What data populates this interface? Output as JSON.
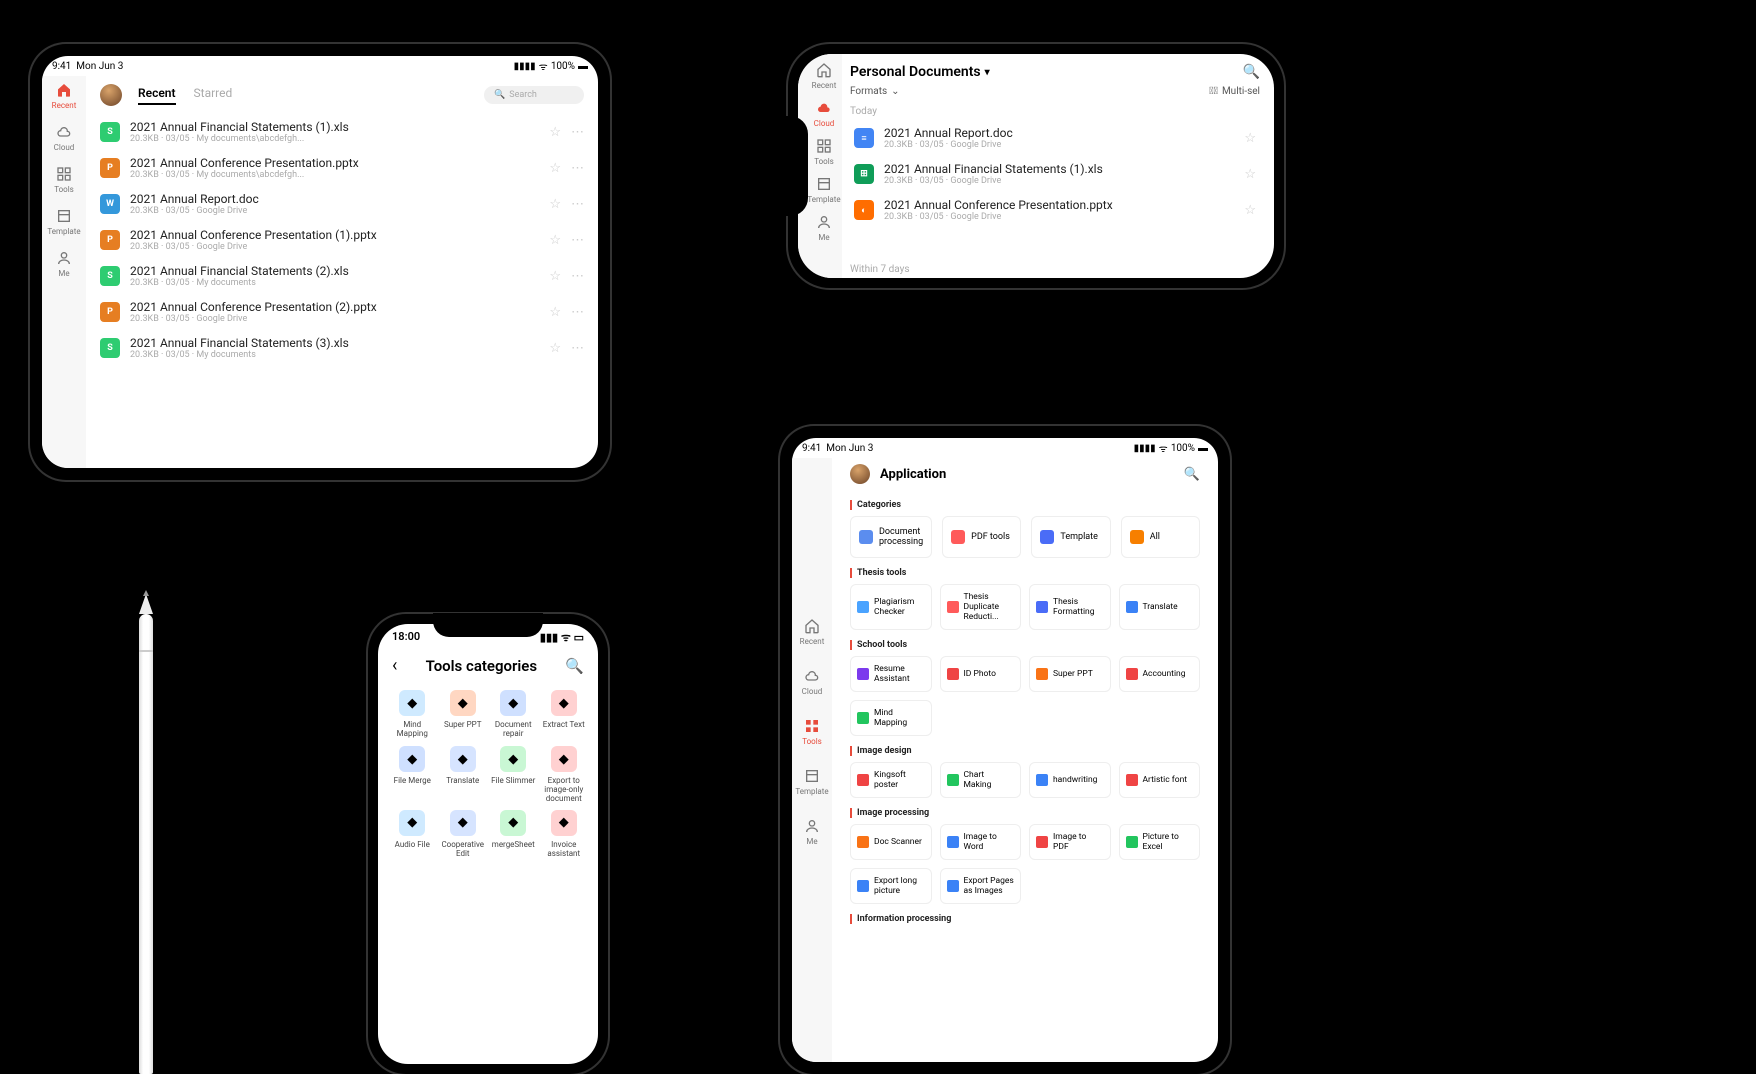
{
  "status": {
    "time": "9:41",
    "day": "Mon Jun 3",
    "battery": "100%"
  },
  "sidebar_labels": {
    "recent": "Recent",
    "cloud": "Cloud",
    "tools": "Tools",
    "template": "Template",
    "me": "Me"
  },
  "d1": {
    "tabs": {
      "recent": "Recent",
      "starred": "Starred"
    },
    "search_placeholder": "Search",
    "files": [
      {
        "icon": "s",
        "glyph": "S",
        "name": "2021 Annual Financial Statements (1).xls",
        "meta": "20.3KB · 03/05 · My documents\\abcdefgh..."
      },
      {
        "icon": "p",
        "glyph": "P",
        "name": "2021 Annual Conference Presentation.pptx",
        "meta": "20.3KB · 03/05 · My documents\\abcdefgh..."
      },
      {
        "icon": "w",
        "glyph": "W",
        "name": "2021 Annual Report.doc",
        "meta": "20.3KB · 03/05 · Google Drive"
      },
      {
        "icon": "p",
        "glyph": "P",
        "name": "2021 Annual Conference Presentation (1).pptx",
        "meta": "20.3KB · 03/05 · Google Drive"
      },
      {
        "icon": "s",
        "glyph": "S",
        "name": "2021 Annual Financial Statements (2).xls",
        "meta": "20.3KB · 03/05 · My documents"
      },
      {
        "icon": "p",
        "glyph": "P",
        "name": "2021 Annual Conference Presentation (2).pptx",
        "meta": "20.3KB · 03/05 · Google Drive"
      },
      {
        "icon": "s",
        "glyph": "S",
        "name": "2021 Annual Financial Statements (3).xls",
        "meta": "20.3KB · 03/05 · My documents"
      }
    ]
  },
  "d2": {
    "title": "Personal Documents",
    "formats": "Formats",
    "multiselect": "Multi-sel",
    "section_today": "Today",
    "section_within7": "Within 7 days",
    "files": [
      {
        "icon": "gd",
        "glyph": "≡",
        "name": "2021 Annual Report.doc",
        "meta": "20.3KB · 03/05 · Google Drive"
      },
      {
        "icon": "gs",
        "glyph": "⊞",
        "name": "2021 Annual Financial Statements (1).xls",
        "meta": "20.3KB · 03/05 · Google Drive"
      },
      {
        "icon": "gp",
        "glyph": "◐",
        "name": "2021 Annual Conference Presentation.pptx",
        "meta": "20.3KB · 03/05 · Google Drive"
      }
    ]
  },
  "d3": {
    "title": "Application",
    "sections": {
      "categories": "Categories",
      "thesis": "Thesis tools",
      "school": "School tools",
      "image_design": "Image design",
      "image_processing": "Image processing",
      "info": "Information processing"
    },
    "categories": [
      {
        "label": "Document processing",
        "color": "#5b8def"
      },
      {
        "label": "PDF tools",
        "color": "#ff5a5a"
      },
      {
        "label": "Template",
        "color": "#4a6cf7"
      },
      {
        "label": "All",
        "color": "#f77f00"
      }
    ],
    "thesis": [
      {
        "label": "Plagiarism Checker",
        "color": "#4aa3ff"
      },
      {
        "label": "Thesis Duplicate Reducti...",
        "color": "#ff5a5a"
      },
      {
        "label": "Thesis Formatting",
        "color": "#4a6cf7"
      },
      {
        "label": "Translate",
        "color": "#3b82f6"
      }
    ],
    "school": [
      {
        "label": "Resume Assistant",
        "color": "#7c3aed"
      },
      {
        "label": "ID Photo",
        "color": "#ef4444"
      },
      {
        "label": "Super PPT",
        "color": "#f97316"
      },
      {
        "label": "Accounting",
        "color": "#ef4444"
      },
      {
        "label": "Mind Mapping",
        "color": "#22c55e"
      }
    ],
    "image_design": [
      {
        "label": "Kingsoft  poster",
        "color": "#ef4444"
      },
      {
        "label": "Chart Making",
        "color": "#22c55e"
      },
      {
        "label": "handwriting",
        "color": "#3b82f6"
      },
      {
        "label": "Artistic font",
        "color": "#ef4444"
      }
    ],
    "image_processing": [
      {
        "label": "Doc Scanner",
        "color": "#f97316"
      },
      {
        "label": "Image to Word",
        "color": "#3b82f6"
      },
      {
        "label": "Image to PDF",
        "color": "#ef4444"
      },
      {
        "label": "Picture to Excel",
        "color": "#22c55e"
      },
      {
        "label": "Export long picture",
        "color": "#3b82f6"
      },
      {
        "label": "Export Pages as Images",
        "color": "#3b82f6"
      }
    ]
  },
  "d4": {
    "time": "18:00",
    "title": "Tools categories",
    "tools": [
      {
        "label": "Mind Mapping",
        "color": "#cfeaff"
      },
      {
        "label": "Super PPT",
        "color": "#ffd7c2"
      },
      {
        "label": "Document repair",
        "color": "#cfe0ff"
      },
      {
        "label": "Extract Text",
        "color": "#ffd1d1"
      },
      {
        "label": "File Merge",
        "color": "#cfe0ff"
      },
      {
        "label": "Translate",
        "color": "#d6e4ff"
      },
      {
        "label": "File Slimmer",
        "color": "#c9f7d4"
      },
      {
        "label": "Export to image-only document",
        "color": "#ffd1d1"
      },
      {
        "label": "Audio File",
        "color": "#cfeaff"
      },
      {
        "label": "Cooperative Edit",
        "color": "#d6e4ff"
      },
      {
        "label": "mergeSheet",
        "color": "#c9f7d4"
      },
      {
        "label": "Invoice assistant",
        "color": "#ffd1d1"
      }
    ]
  }
}
